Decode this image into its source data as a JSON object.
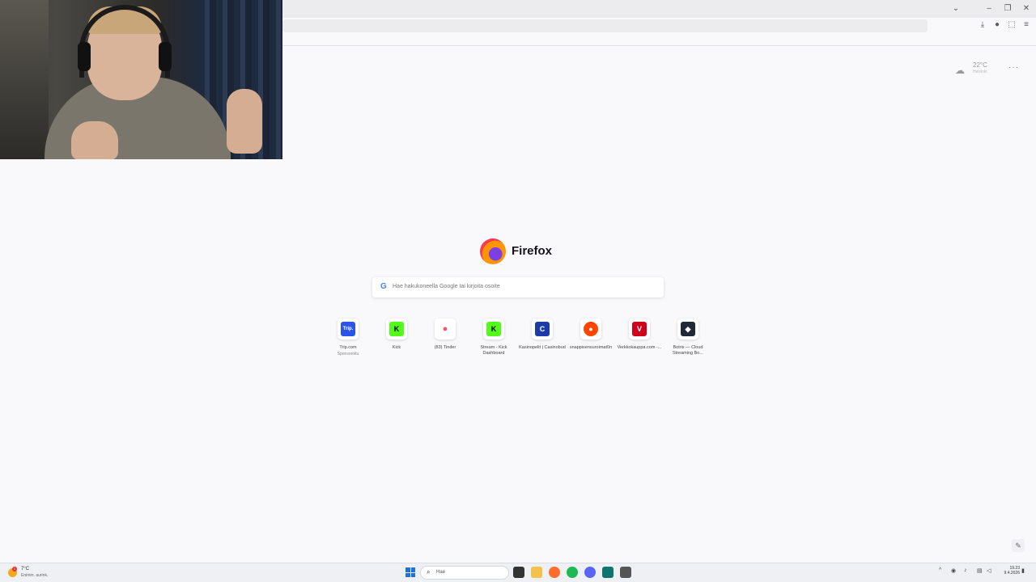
{
  "browser": {
    "window_controls": {
      "minimize": "–",
      "restore": "❐",
      "close": "✕",
      "tab_list": "⌄"
    },
    "toolbar_icons": [
      "download-icon",
      "account-icon",
      "extensions-icon",
      "menu-icon"
    ]
  },
  "newtab": {
    "weather": {
      "temperature": "22°C",
      "city": "Helsinki"
    },
    "brand": "Firefox",
    "search": {
      "placeholder": "Hae hakukoneella Google tai kirjoita osoite"
    },
    "shortcuts": [
      {
        "label": "Trip.com",
        "sub": "Sponsoroitu",
        "glyph": "Trip.",
        "color": "#2b54e8"
      },
      {
        "label": "Kick",
        "sub": "",
        "glyph": "K",
        "color": "#53fc18"
      },
      {
        "label": "(83) Tinder",
        "sub": "",
        "glyph": "●",
        "color": "#fd4f68"
      },
      {
        "label": "Stream - Kick Dashboard",
        "sub": "",
        "glyph": "K",
        "color": "#53fc18"
      },
      {
        "label": "Kasinopelit | Casinobud",
        "sub": "",
        "glyph": "C",
        "color": "#1c3aa8"
      },
      {
        "label": "snappisensuroimat0n",
        "sub": "",
        "glyph": "●",
        "color": "#ff4500"
      },
      {
        "label": "Verkkokauppa.com -...",
        "sub": "",
        "glyph": "V",
        "color": "#d0021b"
      },
      {
        "label": "Botrix — Cloud Streaming Bo...",
        "sub": "",
        "glyph": "◆",
        "color": "#1f2937"
      }
    ]
  },
  "taskbar": {
    "weather": {
      "temperature": "7°C",
      "condition": "Enimm. aurink."
    },
    "search_placeholder": "Hae",
    "clock": {
      "time": "19.23",
      "date": "9.4.2026"
    }
  }
}
